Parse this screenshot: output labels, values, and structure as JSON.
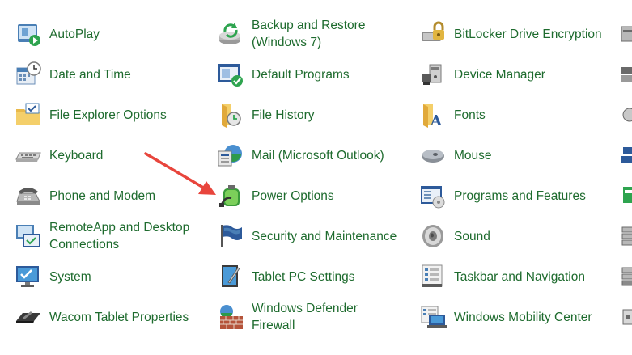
{
  "items": [
    {
      "label": "AutoPlay",
      "icon": "autoplay-icon"
    },
    {
      "label": "Backup and Restore\n(Windows 7)",
      "icon": "backup-restore-icon"
    },
    {
      "label": "BitLocker Drive Encryption",
      "icon": "bitlocker-icon"
    },
    {
      "label": "Date and Time",
      "icon": "date-time-icon"
    },
    {
      "label": "Default Programs",
      "icon": "default-programs-icon"
    },
    {
      "label": "Device Manager",
      "icon": "device-manager-icon"
    },
    {
      "label": "File Explorer Options",
      "icon": "file-explorer-options-icon"
    },
    {
      "label": "File History",
      "icon": "file-history-icon"
    },
    {
      "label": "Fonts",
      "icon": "fonts-icon"
    },
    {
      "label": "Keyboard",
      "icon": "keyboard-icon"
    },
    {
      "label": "Mail (Microsoft Outlook)",
      "icon": "mail-icon"
    },
    {
      "label": "Mouse",
      "icon": "mouse-icon"
    },
    {
      "label": "Phone and Modem",
      "icon": "phone-modem-icon"
    },
    {
      "label": "Power Options",
      "icon": "power-options-icon"
    },
    {
      "label": "Programs and Features",
      "icon": "programs-features-icon"
    },
    {
      "label": "RemoteApp and Desktop\nConnections",
      "icon": "remoteapp-icon"
    },
    {
      "label": "Security and Maintenance",
      "icon": "security-maintenance-icon"
    },
    {
      "label": "Sound",
      "icon": "sound-icon"
    },
    {
      "label": "System",
      "icon": "system-icon"
    },
    {
      "label": "Tablet PC Settings",
      "icon": "tablet-pc-icon"
    },
    {
      "label": "Taskbar and Navigation",
      "icon": "taskbar-navigation-icon"
    },
    {
      "label": "Wacom Tablet Properties",
      "icon": "wacom-tablet-icon"
    },
    {
      "label": "Windows Defender\nFirewall",
      "icon": "firewall-icon"
    },
    {
      "label": "Windows Mobility Center",
      "icon": "mobility-center-icon"
    }
  ],
  "colors": {
    "link": "#1e6b2e",
    "annotation_arrow": "#e8453c"
  }
}
